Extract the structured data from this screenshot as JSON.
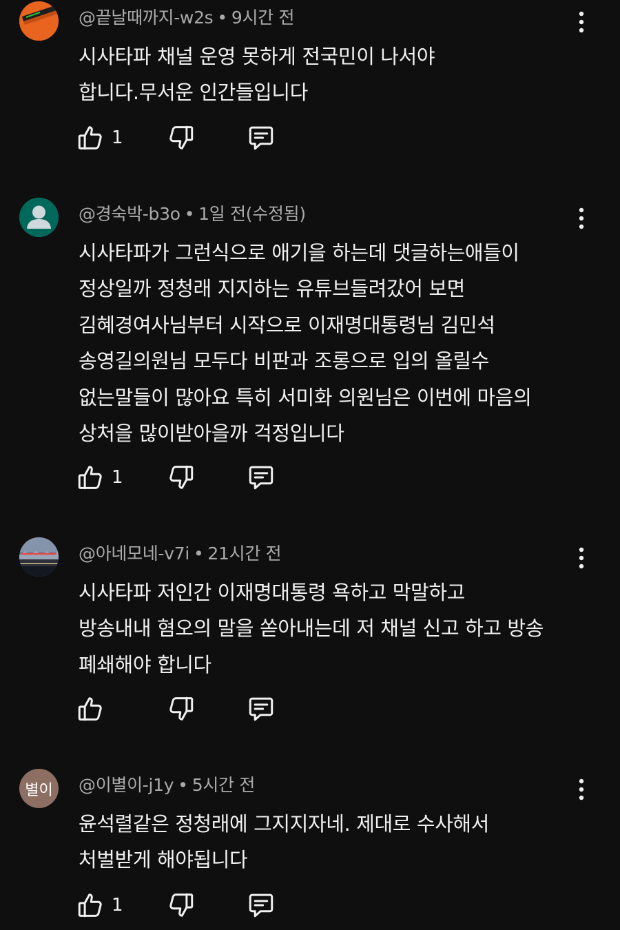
{
  "comments": [
    {
      "author": "@끝날때까지-w2s",
      "separator": "•",
      "time": "9시간 전",
      "lines": [
        "시사타파 채널 운영 못하게 전국민이 나서야",
        "합니다.무서운 인간들입니다"
      ],
      "like_count": "1",
      "avatar_color": "#e8641f"
    },
    {
      "author": "@경숙박-b3o",
      "separator": "•",
      "time": "1일 전(수정됨)",
      "lines": [
        "시사타파가 그런식으로 애기을 하는데 댓글하는애들이",
        "정상일까 정청래 지지하는 유튜브들려갔어 보면",
        "김혜경여사님부터 시작으로 이재명대통령님 김민석",
        "송영길의원님  모두다 비판과 조롱으로 입의 올릴수",
        "없는말들이 많아요 특히 서미화 의원님은 이번에 마음의",
        "상처을 많이받아을까 걱정입니다"
      ],
      "like_count": "1",
      "avatar_color": "#00695c"
    },
    {
      "author": "@아네모네-v7i",
      "separator": "•",
      "time": "21시간 전",
      "lines": [
        "시사타파 저인간 이재명대통령 욕하고 막말하고",
        "방송내내 혐오의 말을 쏟아내는데 저 채널 신고 하고 방송",
        "폐쇄해야 합니다"
      ],
      "like_count": "",
      "avatar_color": "#3a4a5e"
    },
    {
      "author": "@이별이-j1y",
      "separator": "•",
      "time": "5시간 전",
      "lines": [
        "윤석렬같은 정청래에 그지지자네. 제대로 수사해서",
        "처벌받게 해야됩니다"
      ],
      "like_count": "1",
      "avatar_text": "별이",
      "avatar_color": "#8d6e63"
    }
  ],
  "icons": {
    "like": "thumb-up-icon",
    "dislike": "thumb-down-icon",
    "reply": "reply-comment-icon",
    "more": "more-vertical-icon"
  },
  "colors": {
    "background": "#0f0f0f",
    "text": "#f1f1f1",
    "meta": "#aaaaaa"
  }
}
